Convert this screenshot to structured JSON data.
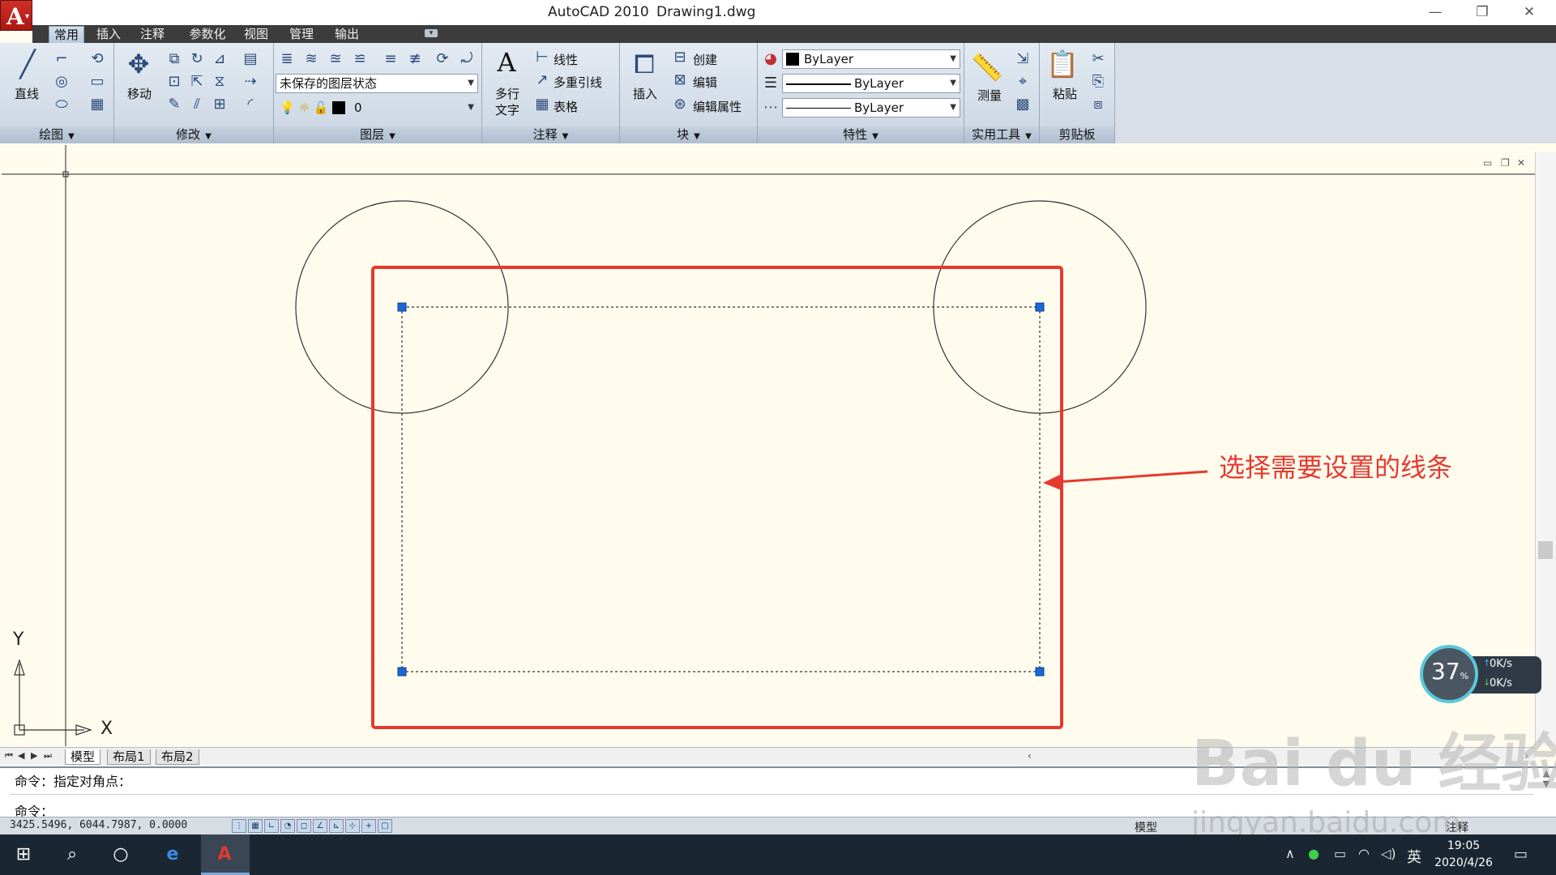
{
  "window": {
    "app_title": "AutoCAD 2010",
    "file_name": "Drawing1.dwg",
    "controls": [
      "—",
      "❐",
      "✕"
    ]
  },
  "ribbon": {
    "tabs": [
      {
        "label": "常用",
        "active": true
      },
      {
        "label": "插入",
        "active": false
      },
      {
        "label": "注释",
        "active": false
      },
      {
        "label": "参数化",
        "active": false
      },
      {
        "label": "视图",
        "active": false
      },
      {
        "label": "管理",
        "active": false
      },
      {
        "label": "输出",
        "active": false
      }
    ],
    "panels": {
      "draw": {
        "title": "绘图",
        "line_label": "直线"
      },
      "modify": {
        "title": "修改",
        "move_label": "移动"
      },
      "layers": {
        "title": "图层",
        "layer_state": "未保存的图层状态",
        "current_layer": "0"
      },
      "annotation": {
        "title": "注释",
        "mtext_label_1": "多行",
        "mtext_label_2": "文字",
        "linear_label": "线性",
        "mleader_label": "多重引线",
        "table_label": "表格"
      },
      "block": {
        "title": "块",
        "insert_label": "插入",
        "create_label": "创建",
        "edit_label": "编辑",
        "edit_attr_label": "编辑属性"
      },
      "properties": {
        "title": "特性",
        "color": "ByLayer",
        "linetype": "ByLayer",
        "lineweight": "ByLayer"
      },
      "utilities": {
        "title": "实用工具",
        "measure_label": "测量"
      },
      "clipboard": {
        "title": "剪贴板",
        "paste_label": "粘贴"
      }
    }
  },
  "drawing": {
    "annotation_text": "选择需要设置的线条",
    "annotation_color": "#e63a2e",
    "grip_color": "#1a6ad6",
    "ucs": {
      "x_label": "X",
      "y_label": "Y"
    }
  },
  "layout_tabs": [
    {
      "label": "模型",
      "active": true
    },
    {
      "label": "布局1",
      "active": false
    },
    {
      "label": "布局2",
      "active": false
    }
  ],
  "command": {
    "history_line": "命令：指定对角点：",
    "prompt": "命令："
  },
  "status": {
    "coordinates": "3425.5496,  6044.7987,  0.0000",
    "model_label": "模型",
    "annotation_label": "注释"
  },
  "speed_widget": {
    "percent": "37",
    "percent_unit": "%",
    "upload": "0K/s",
    "download": "0K/s"
  },
  "taskbar": {
    "ime": "英",
    "time": "19:05",
    "date": "2020/4/26"
  },
  "watermark": {
    "brand": "Bai du 经验",
    "url": "jingyan.baidu.com"
  }
}
